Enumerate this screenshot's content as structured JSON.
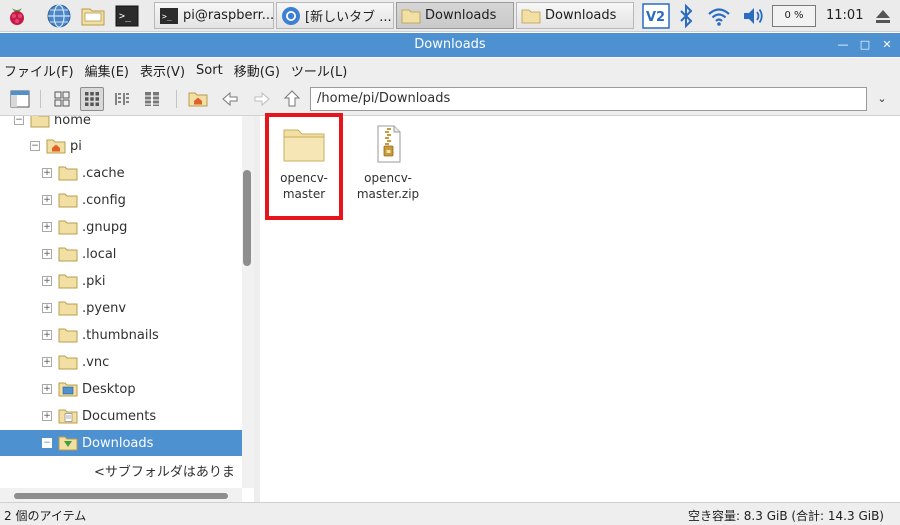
{
  "taskbar": {
    "tasks": [
      {
        "label": "pi@raspberr..."
      },
      {
        "label": "[新しいタブ ..."
      },
      {
        "label": "Downloads"
      },
      {
        "label": "Downloads"
      }
    ],
    "cpu": "0 %",
    "clock": "11:01"
  },
  "window": {
    "title": "Downloads"
  },
  "menu": [
    "ファイル(F)",
    "編集(E)",
    "表示(V)",
    "Sort",
    "移動(G)",
    "ツール(L)"
  ],
  "toolbar": {
    "path": "/home/pi/Downloads"
  },
  "tree": [
    {
      "label": "home"
    },
    {
      "label": "pi"
    },
    {
      "label": ".cache"
    },
    {
      "label": ".config"
    },
    {
      "label": ".gnupg"
    },
    {
      "label": ".local"
    },
    {
      "label": ".pki"
    },
    {
      "label": ".pyenv"
    },
    {
      "label": ".thumbnails"
    },
    {
      "label": ".vnc"
    },
    {
      "label": "Desktop"
    },
    {
      "label": "Documents"
    },
    {
      "label": "Downloads"
    },
    {
      "label": "<サブフォルダはありま"
    }
  ],
  "files": [
    {
      "name": "opencv-master",
      "line1": "opencv-",
      "line2": "master",
      "type": "folder"
    },
    {
      "name": "opencv-master.zip",
      "line1": "opencv-",
      "line2": "master.zip",
      "type": "zip"
    }
  ],
  "status": {
    "left": "2 個のアイテム",
    "right": "空き容量: 8.3 GiB (合計: 14.3 GiB)"
  },
  "colors": {
    "accent": "#4d91d1",
    "highlight_box": "#e8141b",
    "folder": "#f1dfa4"
  }
}
